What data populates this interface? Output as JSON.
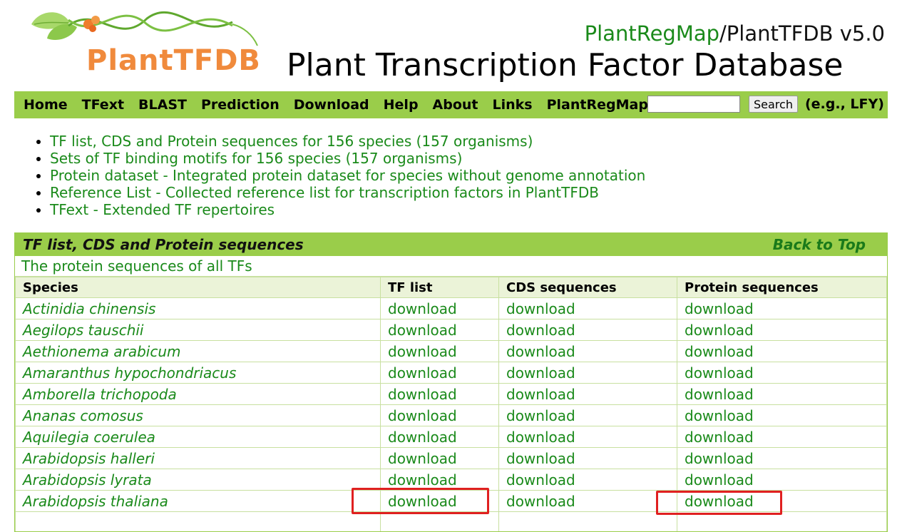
{
  "logo": {
    "text": "PlantTFDB"
  },
  "brand": {
    "plantregmap": "PlantRegMap",
    "rest": "/PlantTFDB v5.0"
  },
  "title": "Plant Transcription Factor Database",
  "nav": {
    "items": [
      "Home",
      "TFext",
      "BLAST",
      "Prediction",
      "Download",
      "Help",
      "About",
      "Links",
      "PlantRegMap"
    ],
    "search_button": "Search",
    "search_hint": "(e.g.,  LFY)"
  },
  "bullets": [
    "TF list, CDS and Protein sequences for 156 species (157 organisms)",
    "Sets of TF binding motifs for 156 species (157 organisms)",
    "Protein dataset - Integrated protein dataset for species without genome annotation",
    "Reference List - Collected reference list for transcription factors in PlantTFDB",
    "TFext - Extended TF repertoires"
  ],
  "section": {
    "title": "TF list, CDS and Protein sequences",
    "back_to_top": "Back to Top",
    "subtitle": "The protein sequences of all TFs",
    "columns": [
      "Species",
      "TF list",
      "CDS sequences",
      "Protein sequences"
    ],
    "rows": [
      {
        "species": "Actinidia chinensis",
        "tf": "download",
        "cds": "download",
        "protein": "download"
      },
      {
        "species": "Aegilops tauschii",
        "tf": "download",
        "cds": "download",
        "protein": "download"
      },
      {
        "species": "Aethionema arabicum",
        "tf": "download",
        "cds": "download",
        "protein": "download"
      },
      {
        "species": "Amaranthus hypochondriacus",
        "tf": "download",
        "cds": "download",
        "protein": "download"
      },
      {
        "species": "Amborella trichopoda",
        "tf": "download",
        "cds": "download",
        "protein": "download"
      },
      {
        "species": "Ananas comosus",
        "tf": "download",
        "cds": "download",
        "protein": "download"
      },
      {
        "species": "Aquilegia coerulea",
        "tf": "download",
        "cds": "download",
        "protein": "download"
      },
      {
        "species": "Arabidopsis halleri",
        "tf": "download",
        "cds": "download",
        "protein": "download"
      },
      {
        "species": "Arabidopsis lyrata",
        "tf": "download",
        "cds": "download",
        "protein": "download"
      },
      {
        "species": "Arabidopsis thaliana",
        "tf": "download",
        "cds": "download",
        "protein": "download"
      }
    ]
  },
  "colors": {
    "nav_green": "#9acd4a",
    "link_green": "#1a8a1a",
    "logo_orange": "#f08a3c",
    "highlight_red": "#e02020"
  }
}
